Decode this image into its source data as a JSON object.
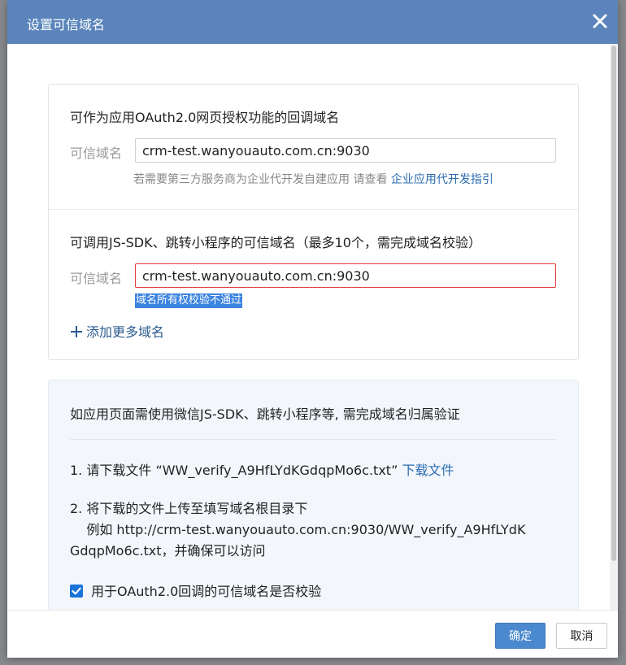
{
  "dialog": {
    "title": "设置可信域名",
    "close_icon": "close-icon"
  },
  "oauth": {
    "section_label": "可作为应用OAuth2.0网页授权功能的回调域名",
    "field_label": "可信域名",
    "value": "crm-test.wanyouauto.com.cn:9030",
    "hint_prefix": "若需要第三方服务商为企业代开发自建应用 请查看 ",
    "hint_link": "企业应用代开发指引"
  },
  "jssdk": {
    "section_label": "可调用JS-SDK、跳转小程序的可信域名（最多10个，需完成域名校验）",
    "field_label": "可信域名",
    "value": "crm-test.wanyouauto.com.cn:9030",
    "error": "域名所有权校验不通过",
    "add_more": "添加更多域名",
    "add_icon": "plus-icon"
  },
  "verify": {
    "title": "如应用页面需使用微信JS-SDK、跳转小程序等, 需完成域名归属验证",
    "step1_prefix": "1. 请下载文件 “WW_verify_A9HfLYdKGdqpMo6c.txt” ",
    "step1_link": "下载文件",
    "step2_line1": "2. 将下载的文件上传至填写域名根目录下",
    "step2_line2": "    例如 http://crm-test.wanyouauto.com.cn:9030/WW_verify_A9HfLYdK",
    "step2_line3": "GdqpMo6c.txt，并确保可以访问",
    "checkbox_label": "用于OAuth2.0回调的可信域名是否校验",
    "checked": true
  },
  "footer": {
    "ok_label": "确定",
    "cancel_label": "取消"
  },
  "colors": {
    "header": "#5a84bb",
    "link": "#2b6cb0",
    "error_border": "#e4393c",
    "primary_button": "#4a89cd"
  }
}
